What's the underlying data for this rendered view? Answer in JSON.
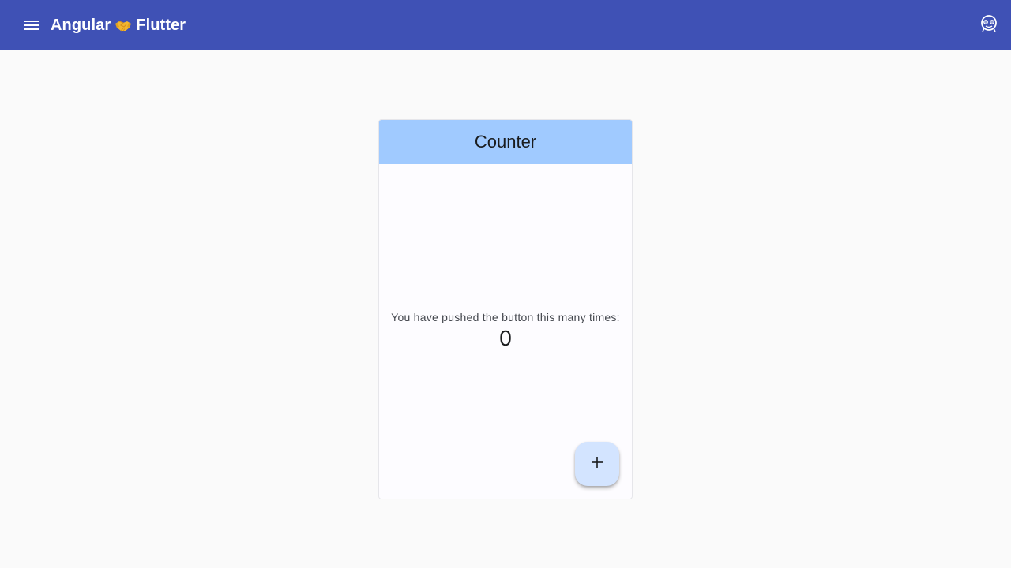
{
  "toolbar": {
    "menu_icon": "menu-icon",
    "title_prefix": "Angular",
    "title_emoji": "🤝",
    "title_suffix": "Flutter",
    "theme_icon": "palette-icon",
    "background_color": "#3f51b5"
  },
  "counter_card": {
    "title": "Counter",
    "header_color": "#a0caff",
    "message": "You have pushed the button this many times:",
    "count": "0",
    "fab_icon": "plus-icon",
    "fab_color": "#d3e4ff"
  }
}
